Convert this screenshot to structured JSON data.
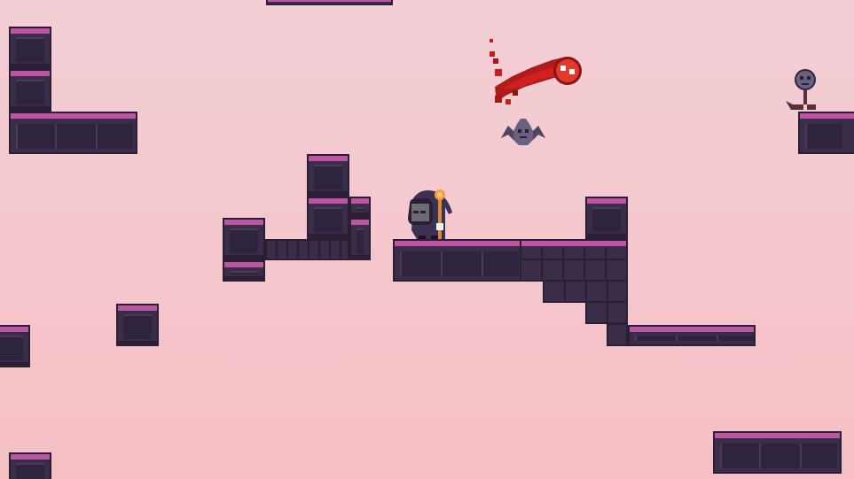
{
  "game": {
    "palette": {
      "sky_top": "#f2cfd5",
      "sky_bottom": "#f5bfc4",
      "stone_body": "#3a2d47",
      "stone_edge": "#2a1f35",
      "stone_top_highlight": "#b957a5",
      "blood_red": "#c81e1e",
      "bat_color": "#6b6080",
      "player_hood": "#3b3150",
      "staff_orb": "#ff9a3c"
    },
    "entities": {
      "player": {
        "icon": "hooded-mage-with-staff-icon"
      },
      "fireball": {
        "icon": "red-fireball-icon"
      },
      "bat": {
        "icon": "bat-enemy-icon"
      },
      "skull_on_spike": {
        "icon": "skull-checkpoint-icon"
      }
    }
  }
}
